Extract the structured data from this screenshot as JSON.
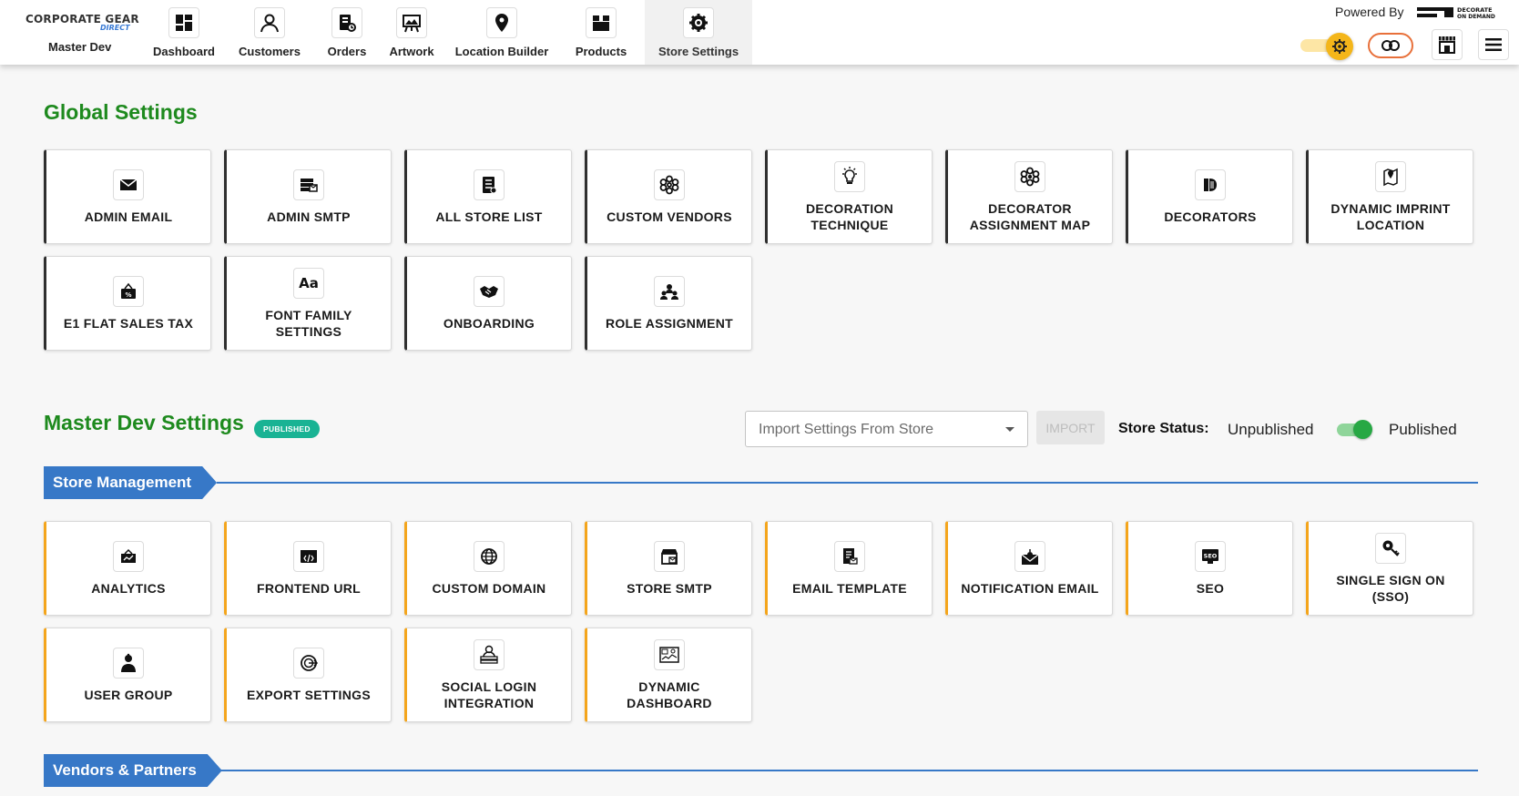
{
  "header": {
    "brand": {
      "line1": "CORPORATE GEAR",
      "line2": "DIRECT"
    },
    "store_name": "Master Dev",
    "nav": [
      {
        "label": "Dashboard",
        "icon": "dashboard-icon"
      },
      {
        "label": "Customers",
        "icon": "customers-icon"
      },
      {
        "label": "Orders",
        "icon": "orders-icon"
      },
      {
        "label": "Artwork",
        "icon": "artwork-icon"
      },
      {
        "label": "Location Builder",
        "icon": "location-icon"
      },
      {
        "label": "Products",
        "icon": "products-icon"
      },
      {
        "label": "Store Settings",
        "icon": "settings-icon",
        "active": true
      }
    ],
    "powered_by": "Powered By",
    "partner_logo": "DECORATE ON DEMAND"
  },
  "global_settings": {
    "title": "Global Settings",
    "tiles": [
      {
        "label": "ADMIN EMAIL",
        "icon": "envelope-icon"
      },
      {
        "label": "ADMIN SMTP",
        "icon": "smtp-icon"
      },
      {
        "label": "ALL STORE LIST",
        "icon": "list-icon"
      },
      {
        "label": "CUSTOM VENDORS",
        "icon": "vendors-icon"
      },
      {
        "label": "DECORATION TECHNIQUE",
        "icon": "lightbulb-icon"
      },
      {
        "label": "DECORATOR ASSIGNMENT MAP",
        "icon": "network-icon"
      },
      {
        "label": "DECORATORS",
        "icon": "decorators-icon"
      },
      {
        "label": "DYNAMIC IMPRINT LOCATION",
        "icon": "map-pin-icon"
      },
      {
        "label": "E1 FLAT SALES TAX",
        "icon": "tax-icon"
      },
      {
        "label": "FONT FAMILY SETTINGS",
        "icon": "font-icon"
      },
      {
        "label": "ONBOARDING",
        "icon": "handshake-icon"
      },
      {
        "label": "ROLE ASSIGNMENT",
        "icon": "role-icon"
      }
    ]
  },
  "master_dev": {
    "title": "Master Dev Settings",
    "badge": "PUBLISHED",
    "import_placeholder": "Import Settings From Store",
    "import_button": "IMPORT",
    "status_label": "Store Status:",
    "status_unpublished": "Unpublished",
    "status_published": "Published",
    "status_published_on": true
  },
  "store_management": {
    "title": "Store Management",
    "tiles": [
      {
        "label": "ANALYTICS",
        "icon": "analytics-icon"
      },
      {
        "label": "FRONTEND URL",
        "icon": "code-icon"
      },
      {
        "label": "CUSTOM DOMAIN",
        "icon": "globe-icon"
      },
      {
        "label": "STORE SMTP",
        "icon": "store-icon"
      },
      {
        "label": "EMAIL TEMPLATE",
        "icon": "template-icon"
      },
      {
        "label": "NOTIFICATION EMAIL",
        "icon": "notification-icon"
      },
      {
        "label": "SEO",
        "icon": "seo-icon"
      },
      {
        "label": "SINGLE SIGN ON (SSO)",
        "icon": "key-icon"
      },
      {
        "label": "USER GROUP",
        "icon": "user-group-icon"
      },
      {
        "label": "EXPORT SETTINGS",
        "icon": "export-icon"
      },
      {
        "label": "SOCIAL LOGIN INTEGRATION",
        "icon": "social-login-icon"
      },
      {
        "label": "DYNAMIC DASHBOARD",
        "icon": "dashboard-chart-icon"
      }
    ]
  },
  "vendors_partners": {
    "title": "Vendors & Partners"
  },
  "colors": {
    "accent_green": "#1e8a1e",
    "ribbon_blue": "#3778c7",
    "store_tile_accent": "#f4a51c",
    "badge_teal": "#19b394"
  }
}
